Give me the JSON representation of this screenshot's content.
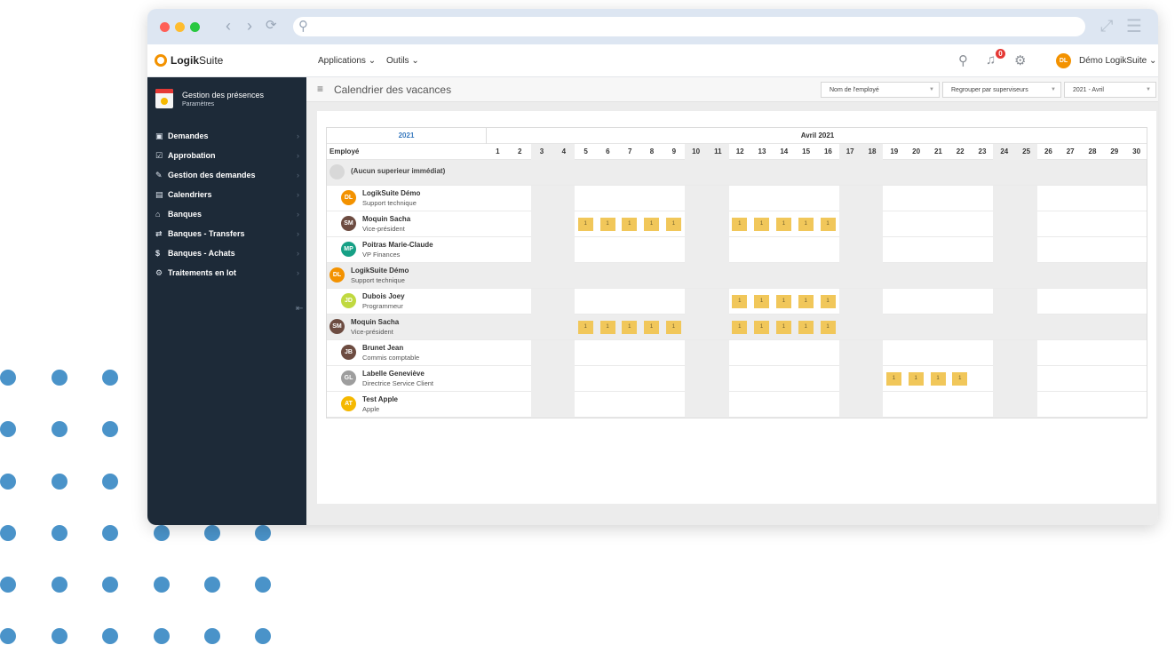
{
  "url": "",
  "app": {
    "brand_bold": "Logik",
    "brand_light": "Suite"
  },
  "topnav": {
    "applications": "Applications",
    "outils": "Outils",
    "notifications": "0",
    "user_initials": "DL",
    "user_name": "Démo LogikSuite"
  },
  "sidebar": {
    "title": "Gestion des présences",
    "subtitle": "Paramètres",
    "items": [
      {
        "label": "Demandes",
        "icon": "calendar-icon"
      },
      {
        "label": "Approbation",
        "icon": "check-calendar-icon"
      },
      {
        "label": "Gestion des demandes",
        "icon": "edit-calendar-icon"
      },
      {
        "label": "Calendriers",
        "icon": "calendar-grid-icon"
      },
      {
        "label": "Banques",
        "icon": "bank-icon"
      },
      {
        "label": "Banques - Transfers",
        "icon": "transfer-icon"
      },
      {
        "label": "Banques - Achats",
        "icon": "money-icon"
      },
      {
        "label": "Traitements en lot",
        "icon": "gears-icon"
      }
    ]
  },
  "page": {
    "title": "Calendrier des vacances"
  },
  "filters": {
    "sort": "Nom de l'employé",
    "group": "Regrouper par superviseurs",
    "period": "2021 - Avril"
  },
  "calendar": {
    "year": "2021",
    "month": "Avril 2021",
    "employee_header": "Employé",
    "days": [
      "1",
      "2",
      "3",
      "4",
      "5",
      "6",
      "7",
      "8",
      "9",
      "10",
      "11",
      "12",
      "13",
      "14",
      "15",
      "16",
      "17",
      "18",
      "19",
      "20",
      "21",
      "22",
      "23",
      "24",
      "25",
      "26",
      "27",
      "28",
      "29",
      "30"
    ],
    "weekend_days": [
      3,
      4,
      10,
      11,
      17,
      18,
      24,
      25
    ],
    "rows": [
      {
        "type": "group",
        "initials": "",
        "name": "(Aucun superieur immédiat)",
        "role": "",
        "color": "#d8d8d8",
        "vacation_days": [],
        "vacation_value": ""
      },
      {
        "type": "employee",
        "initials": "DL",
        "name": "LogikSuite Démo",
        "role": "Support technique",
        "color": "#f39200",
        "vacation_days": [],
        "vacation_value": ""
      },
      {
        "type": "employee",
        "initials": "SM",
        "name": "Moquin Sacha",
        "role": "Vice-président",
        "color": "#6d4c41",
        "vacation_days": [
          5,
          6,
          7,
          8,
          9,
          12,
          13,
          14,
          15,
          16
        ],
        "vacation_value": "1"
      },
      {
        "type": "employee",
        "initials": "MP",
        "name": "Poitras Marie-Claude",
        "role": "VP Finances",
        "color": "#16a085",
        "vacation_days": [],
        "vacation_value": ""
      },
      {
        "type": "group",
        "initials": "DL",
        "name": "LogikSuite Démo",
        "role": "Support technique",
        "color": "#f39200",
        "vacation_days": [],
        "vacation_value": ""
      },
      {
        "type": "employee",
        "initials": "JD",
        "name": "Dubois Joey",
        "role": "Programmeur",
        "color": "#c0d940",
        "vacation_days": [
          12,
          13,
          14,
          15,
          16
        ],
        "vacation_value": "1"
      },
      {
        "type": "group",
        "initials": "SM",
        "name": "Moquin Sacha",
        "role": "Vice-président",
        "color": "#6d4c41",
        "vacation_days": [
          5,
          6,
          7,
          8,
          9,
          12,
          13,
          14,
          15,
          16
        ],
        "vacation_value": "1"
      },
      {
        "type": "employee",
        "initials": "JB",
        "name": "Brunet Jean",
        "role": "Commis comptable",
        "color": "#6d4c41",
        "vacation_days": [],
        "vacation_value": ""
      },
      {
        "type": "employee",
        "initials": "GL",
        "name": "Labelle Geneviève",
        "role": "Directrice Service Client",
        "color": "#9e9e9e",
        "vacation_days": [
          19,
          20,
          21,
          22
        ],
        "vacation_value": "1"
      },
      {
        "type": "employee",
        "initials": "AT",
        "name": "Test Apple",
        "role": "Apple",
        "color": "#f5b800",
        "vacation_days": [],
        "vacation_value": ""
      }
    ]
  },
  "colors": {
    "sidebar_bg": "#1d2a38",
    "accent": "#f39200",
    "vacation": "#f1c75a",
    "weekend": "#ededed",
    "dots": "#4a93c9"
  }
}
